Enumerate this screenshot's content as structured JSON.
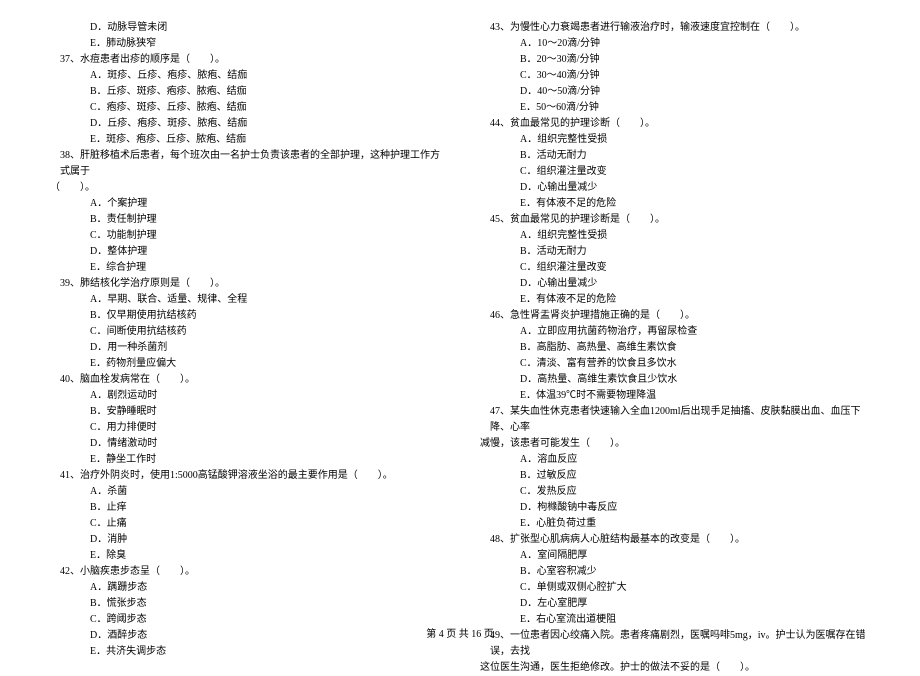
{
  "left": {
    "pre_options": [
      "D．动脉导管未闭",
      "E．肺动脉狭窄"
    ],
    "questions": [
      {
        "num": "37",
        "text": "水痘患者出疹的顺序是（　　）。",
        "options": [
          "A．斑疹、丘疹、疱疹、脓疱、结痂",
          "B．丘疹、斑疹、疱疹、脓疱、结痂",
          "C．疱疹、斑疹、丘疹、脓疱、结痂",
          "D．丘疹、疱疹、斑疹、脓疱、结痂",
          "E．斑疹、疱疹、丘疹、脓疱、结痂"
        ]
      },
      {
        "num": "38",
        "text": "肝脏移植术后患者，每个班次由一名护士负责该患者的全部护理，这种护理工作方式属于",
        "cont": "（　　）。",
        "options": [
          "A．个案护理",
          "B．责任制护理",
          "C．功能制护理",
          "D．整体护理",
          "E．综合护理"
        ]
      },
      {
        "num": "39",
        "text": "肺结核化学治疗原则是（　　）。",
        "options": [
          "A．早期、联合、适量、规律、全程",
          "B．仅早期使用抗结核药",
          "C．间断使用抗结核药",
          "D．用一种杀菌剂",
          "E．药物剂量应偏大"
        ]
      },
      {
        "num": "40",
        "text": "脑血栓发病常在（　　）。",
        "options": [
          "A．剧烈运动时",
          "B．安静睡眠时",
          "C．用力排便时",
          "D．情绪激动时",
          "E．静坐工作时"
        ]
      },
      {
        "num": "41",
        "text": "治疗外阴炎时，使用1:5000高锰酸钾溶液坐浴的最主要作用是（　　）。",
        "options": [
          "A．杀菌",
          "B．止痒",
          "C．止痛",
          "D．消肿",
          "E．除臭"
        ]
      },
      {
        "num": "42",
        "text": "小脑疾患步态呈（　　）。",
        "options": [
          "A．蹒跚步态",
          "B．慌张步态",
          "C．跨阈步态",
          "D．酒醉步态",
          "E．共济失调步态"
        ]
      }
    ]
  },
  "right": {
    "questions": [
      {
        "num": "43",
        "text": "为慢性心力衰竭患者进行输液治疗时，输液速度宜控制在（　　）。",
        "options": [
          "A．10～20滴/分钟",
          "B．20～30滴/分钟",
          "C．30～40滴/分钟",
          "D．40～50滴/分钟",
          "E．50～60滴/分钟"
        ]
      },
      {
        "num": "44",
        "text": "贫血最常见的护理诊断（　　）。",
        "options": [
          "A．组织完整性受损",
          "B．活动无耐力",
          "C．组织灌注量改变",
          "D．心输出量减少",
          "E．有体液不足的危险"
        ]
      },
      {
        "num": "45",
        "text": "贫血最常见的护理诊断是（　　）。",
        "options": [
          "A．组织完整性受损",
          "B．活动无耐力",
          "C．组织灌注量改变",
          "D．心输出量减少",
          "E．有体液不足的危险"
        ]
      },
      {
        "num": "46",
        "text": "急性肾盂肾炎护理措施正确的是（　　）。",
        "options": [
          "A．立即应用抗菌药物治疗，再留尿检查",
          "B．高脂肪、高热量、高维生素饮食",
          "C．清淡、富有营养的饮食且多饮水",
          "D．高热量、高维生素饮食且少饮水",
          "E．体温39℃时不需要物理降温"
        ]
      },
      {
        "num": "47",
        "text": "某失血性休克患者快速输入全血1200ml后出现手足抽搐、皮肤黏膜出血、血压下降、心率",
        "cont": "减慢，该患者可能发生（　　）。",
        "options": [
          "A．溶血反应",
          "B．过敏反应",
          "C．发热反应",
          "D．枸橼酸钠中毒反应",
          "E．心脏负荷过重"
        ]
      },
      {
        "num": "48",
        "text": "扩张型心肌病病人心脏结构最基本的改变是（　　）。",
        "options": [
          "A．室间隔肥厚",
          "B．心室容积减少",
          "C．单侧或双侧心腔扩大",
          "D．左心室肥厚",
          "E．右心室流出道梗阻"
        ]
      },
      {
        "num": "49",
        "text": "一位患者因心绞痛入院。患者疼痛剧烈，医嘱吗啡5mg，iv。护士认为医嘱存在错误，去找",
        "cont": "这位医生沟通，医生拒绝修改。护士的做法不妥的是（　　）。"
      }
    ]
  },
  "footer": "第 4 页 共 16 页"
}
